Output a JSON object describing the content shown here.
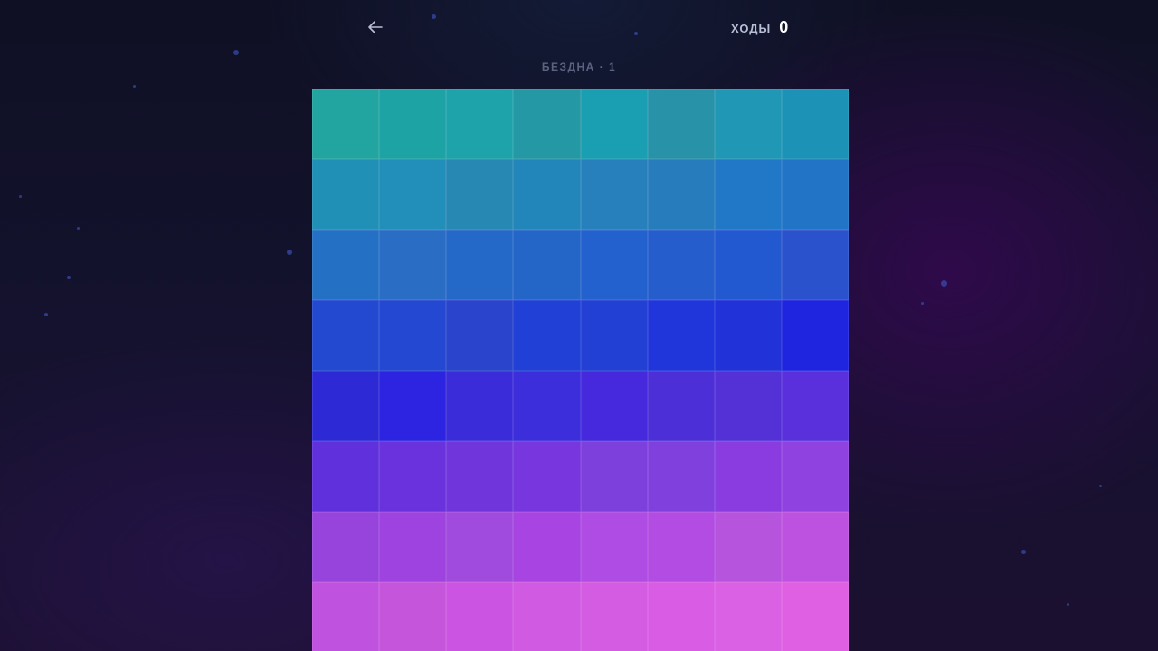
{
  "header": {
    "back_icon": "arrow-left-icon",
    "moves_label": "ХОДЫ",
    "moves_count": "0"
  },
  "level": {
    "title": "БЕЗДНА · 1"
  },
  "colors": {
    "moves_label": "#b8bed4",
    "level_title": "#5c6280",
    "star": "#3a4fb0"
  },
  "board": {
    "rows": 8,
    "cols": 8,
    "tiles": [
      [
        "#22a5a0",
        "#1ea3a5",
        "#1ea3aa",
        "#2498a4",
        "#1a9eb2",
        "#2792a8",
        "#2097b4",
        "#1c92b6"
      ],
      [
        "#2090b6",
        "#228eba",
        "#2788b4",
        "#2386bb",
        "#2780bc",
        "#277cbc",
        "#2078c6",
        "#2174c6"
      ],
      [
        "#2370c4",
        "#296ec4",
        "#2468c8",
        "#2466c8",
        "#2261ce",
        "#255ecc",
        "#2258d0",
        "#2a52cc"
      ],
      [
        "#2249d0",
        "#2448d2",
        "#2a44cc",
        "#2040d6",
        "#2240d4",
        "#2036da",
        "#2232d9",
        "#1f24de"
      ],
      [
        "#2d2ad5",
        "#2c24e0",
        "#3a2cd8",
        "#3c2edb",
        "#4629dc",
        "#4c2fd6",
        "#5431d6",
        "#5a30dc"
      ],
      [
        "#6030dc",
        "#6a32dc",
        "#7036dc",
        "#7836de",
        "#7e40dc",
        "#8040de",
        "#8a3ce0",
        "#9042e0"
      ],
      [
        "#9644dc",
        "#9e42e0",
        "#a04ade",
        "#a844e2",
        "#ae4ce4",
        "#b24ce2",
        "#b654de",
        "#be52e0"
      ],
      [
        "#c052e0",
        "#c556dc",
        "#cc54e2",
        "#d05ae2",
        "#d45ce2",
        "#d85ce4",
        "#da60e4",
        "#e060e4"
      ]
    ]
  }
}
